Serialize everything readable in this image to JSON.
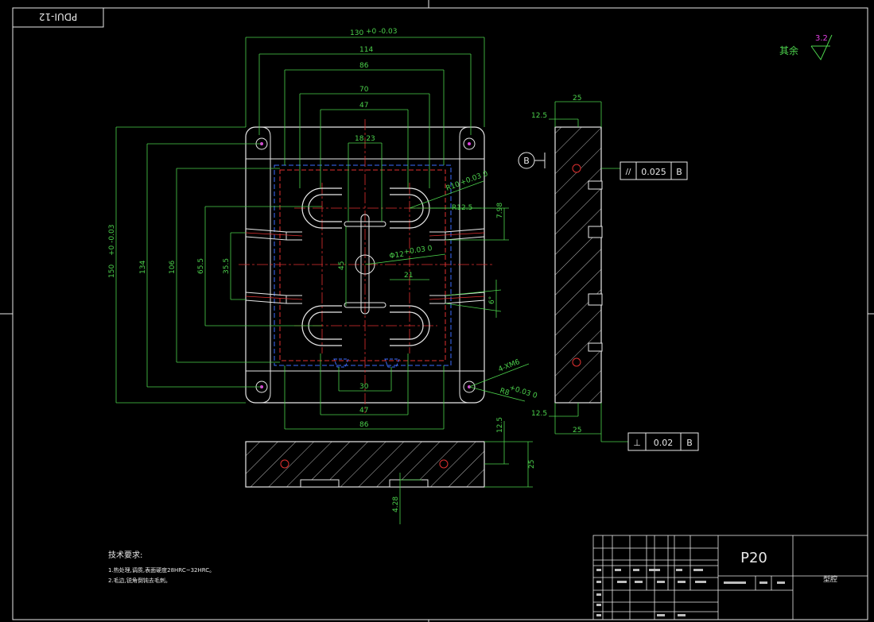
{
  "drawing": {
    "id_stamp": "PDUI-12",
    "roughness": {
      "label": "其余",
      "value": "3.2"
    },
    "title_block": {
      "part_no": "P20",
      "name": "型腔"
    },
    "notes": {
      "title": "技术要求:",
      "items": [
        "1.热处理,调质,表面硬度28HRC~32HRC。",
        "2.毛边,锐角倒钝去毛刺。"
      ]
    },
    "datum": "B",
    "tolerance_frames": [
      {
        "symbol": "//",
        "value": "0.025",
        "datum": "B"
      },
      {
        "symbol": "⊥",
        "value": "0.02",
        "datum": "B"
      }
    ],
    "dimensions": {
      "top_overall": "130",
      "top_overall_tol": "+0 -0.03",
      "w114": "114",
      "w86_top": "86",
      "w70": "70",
      "w47_top": "47",
      "w18": "18.23",
      "left_overall": "150",
      "left_overall_tol": "+0 -0.03",
      "h134": "134",
      "h106": "106",
      "h65": "65.5",
      "h35": "35.5",
      "h45": "45",
      "r10": "R10",
      "r10_tol": "+0.03 0",
      "r12": "R12.5",
      "d12": "Φ12",
      "d12_tol": "+0.03 0",
      "v798": "7.98",
      "w21": "21",
      "ang6": "6°",
      "m6": "4-XM6",
      "r8": "R8",
      "r8_tol": "+0.03 0",
      "w30": "30",
      "w47_bot": "47",
      "w86_bot": "86",
      "side_25_top": "25",
      "side_125_top": "12.5",
      "side_125_bot": "12.5",
      "side_25_bot": "25",
      "front_125": "12.5",
      "front_25": "25",
      "front_428": "4.28"
    }
  }
}
